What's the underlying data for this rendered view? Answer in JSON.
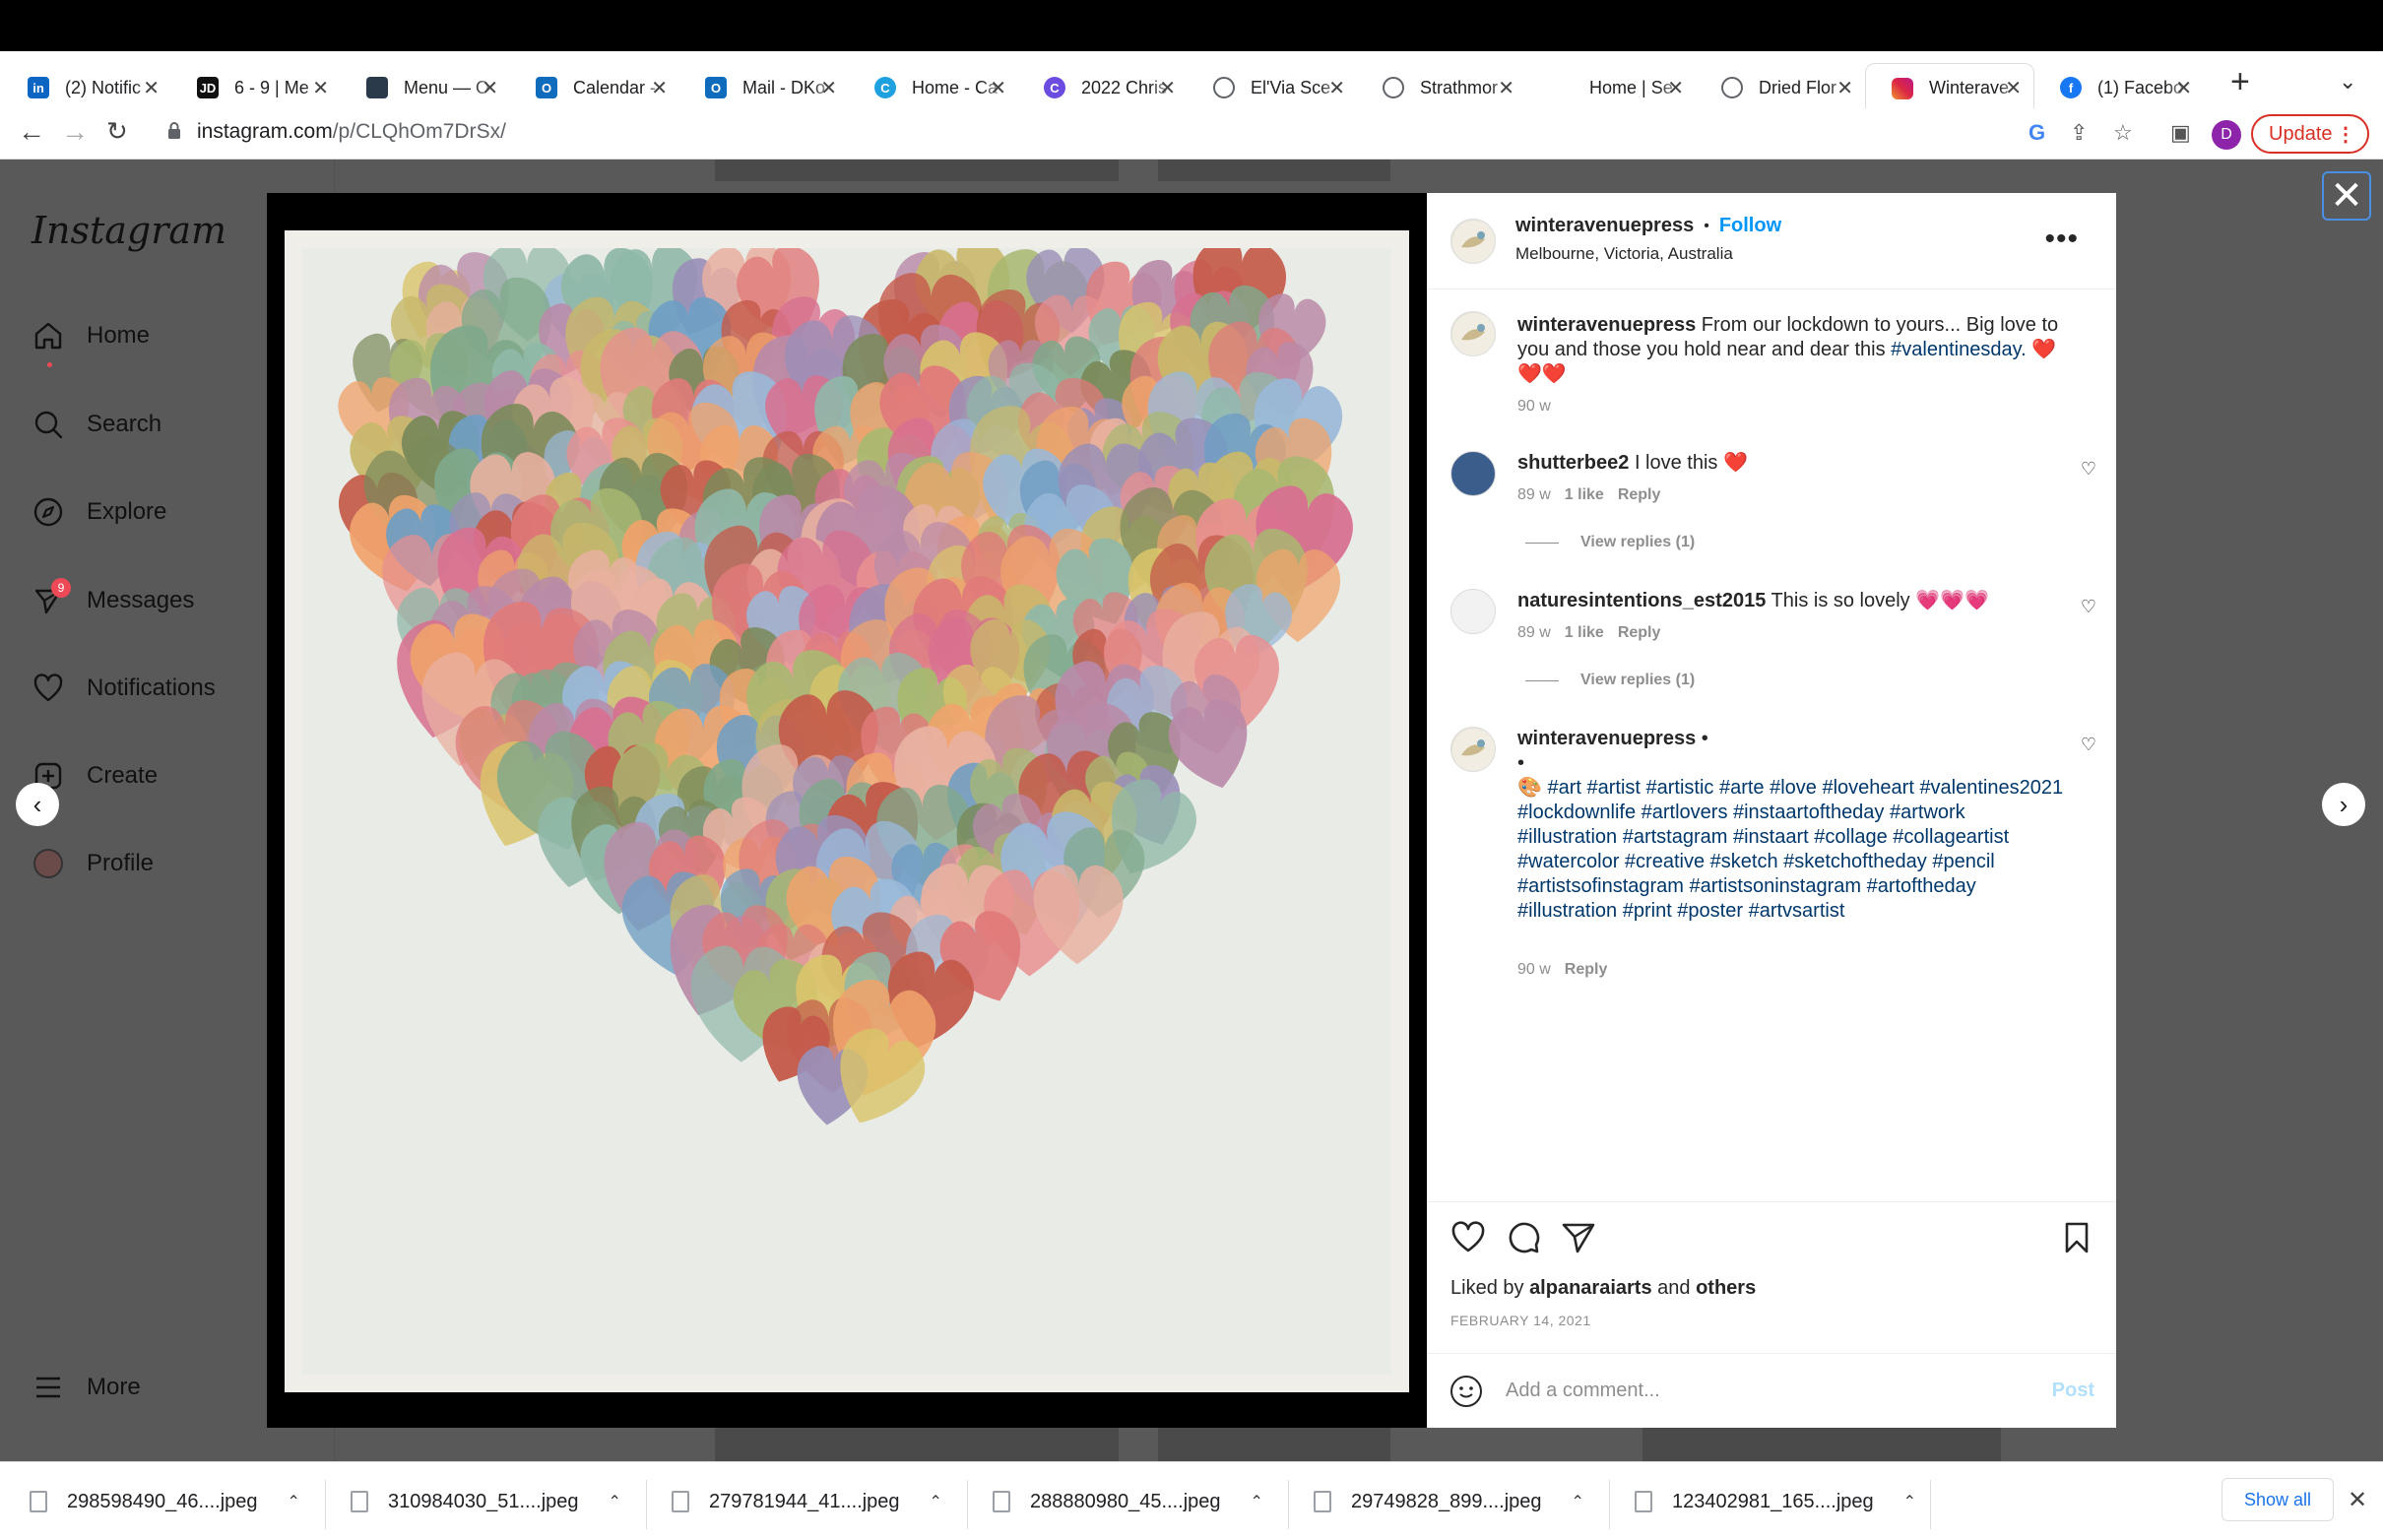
{
  "browser": {
    "tabs": [
      {
        "title": "(2) Notific",
        "icon": "linkedin-icon",
        "color": "#0a66c2",
        "glyph": "in"
      },
      {
        "title": "6 - 9 | Me",
        "icon": "jd-icon",
        "color": "#111111",
        "glyph": "JD"
      },
      {
        "title": "Menu — O",
        "icon": "menu-site-icon",
        "color": "#2b3a4a",
        "glyph": ""
      },
      {
        "title": "Calendar -",
        "icon": "outlook-icon",
        "color": "#0f6cbd",
        "glyph": "O"
      },
      {
        "title": "Mail - DKo",
        "icon": "outlook-icon",
        "color": "#0f6cbd",
        "glyph": "O"
      },
      {
        "title": "Home - Ca",
        "icon": "canva-icon",
        "color": "#1fa1e0",
        "glyph": "C"
      },
      {
        "title": "2022 Chris",
        "icon": "canva-icon",
        "color": "#6c4ce0",
        "glyph": "C"
      },
      {
        "title": "El'Via Sce",
        "icon": "globe-icon",
        "color": "#5f6368",
        "glyph": ""
      },
      {
        "title": "Strathmor",
        "icon": "globe-icon",
        "color": "#5f6368",
        "glyph": ""
      },
      {
        "title": "Home | Se",
        "icon": "blank-icon",
        "color": "#ffffff",
        "glyph": ""
      },
      {
        "title": "Dried Flor",
        "icon": "globe-icon",
        "color": "#5f6368",
        "glyph": ""
      },
      {
        "title": "Winterave",
        "icon": "instagram-icon",
        "color": "#d6249f",
        "glyph": ""
      },
      {
        "title": "(1) Facebo",
        "icon": "facebook-icon",
        "color": "#1877f2",
        "glyph": "f"
      }
    ],
    "url_host": "instagram.com",
    "url_path": "/p/CLQhOm7DrSx/",
    "profile_initial": "D",
    "update_label": "Update"
  },
  "sidebar": {
    "logo": "Instagram",
    "items": [
      {
        "label": "Home",
        "icon": "home-icon"
      },
      {
        "label": "Search",
        "icon": "search-icon"
      },
      {
        "label": "Explore",
        "icon": "compass-icon"
      },
      {
        "label": "Messages",
        "icon": "messenger-icon",
        "badge": "9"
      },
      {
        "label": "Notifications",
        "icon": "heart-icon"
      },
      {
        "label": "Create",
        "icon": "plus-square-icon"
      },
      {
        "label": "Profile",
        "icon": "avatar"
      }
    ],
    "more_label": "More"
  },
  "post": {
    "author": "winteravenuepress",
    "dot": "•",
    "follow_label": "Follow",
    "location": "Melbourne, Victoria, Australia",
    "caption_text": "From our lockdown to yours... Big love to you and those you hold near and dear this",
    "caption_tag": "#valentinesday.",
    "caption_hearts": "❤️",
    "caption_hearts2": "❤️❤️",
    "caption_time": "90 w",
    "comments": [
      {
        "user": "shutterbee2",
        "text": "I love this ❤️",
        "time": "89 w",
        "likes": "1 like",
        "reply": "Reply",
        "view_replies": "View replies (1)"
      },
      {
        "user": "naturesintentions_est2015",
        "text": "This is so lovely 💗💗💗",
        "time": "89 w",
        "likes": "1 like",
        "reply": "Reply",
        "view_replies": "View replies (1)"
      }
    ],
    "hashtag_comment": {
      "user": "winteravenuepress",
      "dot": "•",
      "dot2": "•",
      "emoji": "🎨",
      "tags": "#art #artist #artistic #arte #love #loveheart #valentines2021 #lockdownlife #artlovers #instaartoftheday #artwork #illustration #artstagram #instaart #collage #collageartist #watercolor #creative #sketch #sketchoftheday #pencil #artistsofinstagram #artistsoninstagram #artoftheday #illustration #print #poster #artvsartist",
      "time": "90 w",
      "reply": "Reply"
    },
    "liked_by_prefix": "Liked by",
    "liked_by_user": "alpanaraiarts",
    "liked_by_and": "and",
    "liked_by_others": "others",
    "date": "FEBRUARY 14, 2021",
    "add_comment_placeholder": "Add a comment...",
    "post_label": "Post"
  },
  "downloads": {
    "items": [
      "298598490_46....jpeg",
      "310984030_51....jpeg",
      "279781944_41....jpeg",
      "288880980_45....jpeg",
      "29749828_899....jpeg",
      "123402981_165....jpeg"
    ],
    "show_all_label": "Show all"
  },
  "colors": {
    "accent": "#0095f6",
    "badge": "#ed4956"
  }
}
